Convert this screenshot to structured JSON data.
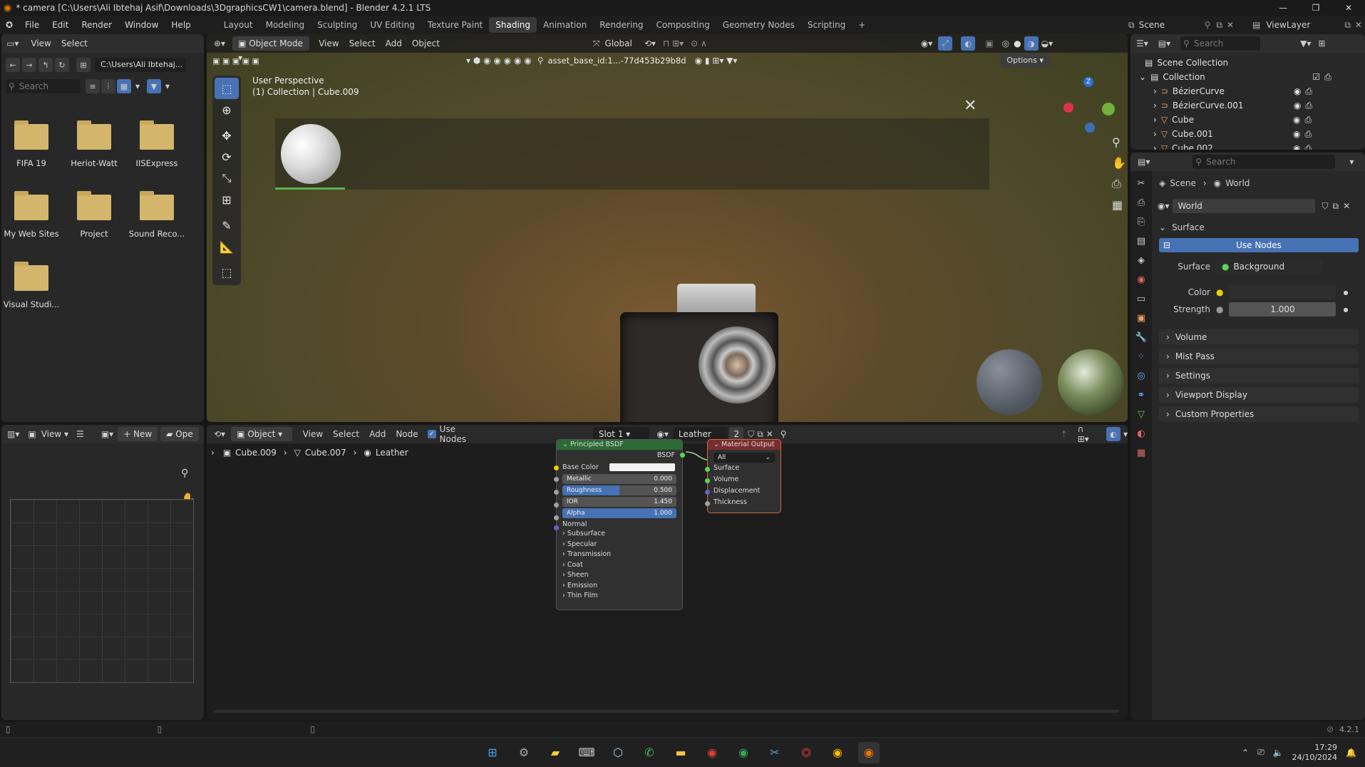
{
  "window": {
    "title": "* camera [C:\\Users\\Ali Ibtehaj Asif\\Downloads\\3DgraphicsCW1\\camera.blend] - Blender 4.2.1 LTS"
  },
  "menus": [
    "File",
    "Edit",
    "Render",
    "Window",
    "Help"
  ],
  "workspaces": [
    "Layout",
    "Modeling",
    "Sculpting",
    "UV Editing",
    "Texture Paint",
    "Shading",
    "Animation",
    "Rendering",
    "Compositing",
    "Geometry Nodes",
    "Scripting"
  ],
  "active_workspace": "Shading",
  "scene": {
    "name": "Scene",
    "view_layer": "ViewLayer"
  },
  "file_browser": {
    "menu": [
      "View",
      "Select"
    ],
    "path": "C:\\Users\\Ali Ibtehaj...",
    "search_placeholder": "Search",
    "folders": [
      "FIFA 19",
      "Heriot-Watt",
      "IISExpress",
      "My Web Sites",
      "Project",
      "Sound Reco...",
      "Visual Studi..."
    ]
  },
  "viewport": {
    "mode": "Object Mode",
    "menu": [
      "View",
      "Select",
      "Add",
      "Object"
    ],
    "orientation": "Global",
    "asset": "asset_base_id:1...-77d453b29b8d",
    "options": "Options",
    "perspective": "User Perspective",
    "collection_info": "(1) Collection | Cube.009"
  },
  "outliner": {
    "search_placeholder": "Search",
    "root": "Scene Collection",
    "collection": "Collection",
    "objects": [
      "BézierCurve",
      "BézierCurve.001",
      "Cube",
      "Cube.001",
      "Cube.002"
    ]
  },
  "properties": {
    "search_placeholder": "Search",
    "breadcrumb": [
      "Scene",
      "World"
    ],
    "world_name": "World",
    "surface_section": "Surface",
    "use_nodes": "Use Nodes",
    "surface_label": "Surface",
    "surface_value": "Background",
    "color_label": "Color",
    "strength_label": "Strength",
    "strength_value": "1.000",
    "sections": [
      "Volume",
      "Mist Pass",
      "Settings",
      "Viewport Display",
      "Custom Properties"
    ]
  },
  "image_editor": {
    "menu": [
      "View"
    ],
    "new_label": "New",
    "open_label": "Ope"
  },
  "node_editor": {
    "type": "Object",
    "menu": [
      "View",
      "Select",
      "Add",
      "Node"
    ],
    "use_nodes": "Use Nodes",
    "slot": "Slot 1",
    "material": "Leather",
    "users": "2",
    "breadcrumb": [
      "Cube.009",
      "Cube.007",
      "Leather"
    ],
    "bsdf": {
      "title": "Principled BSDF",
      "out": "BSDF",
      "base_color": "Base Color",
      "fields": [
        {
          "label": "Metallic",
          "value": "0.000"
        },
        {
          "label": "Roughness",
          "value": "0.500"
        },
        {
          "label": "IOR",
          "value": "1.450"
        },
        {
          "label": "Alpha",
          "value": "1.000"
        }
      ],
      "normal": "Normal",
      "panels": [
        "Subsurface",
        "Specular",
        "Transmission",
        "Coat",
        "Sheen",
        "Emission",
        "Thin Film"
      ]
    },
    "output": {
      "title": "Material Output",
      "target": "All",
      "inputs": [
        "Surface",
        "Volume",
        "Displacement",
        "Thickness"
      ]
    }
  },
  "status": {
    "version": "4.2.1"
  },
  "taskbar": {
    "time": "17:29",
    "date": "24/10/2024"
  }
}
